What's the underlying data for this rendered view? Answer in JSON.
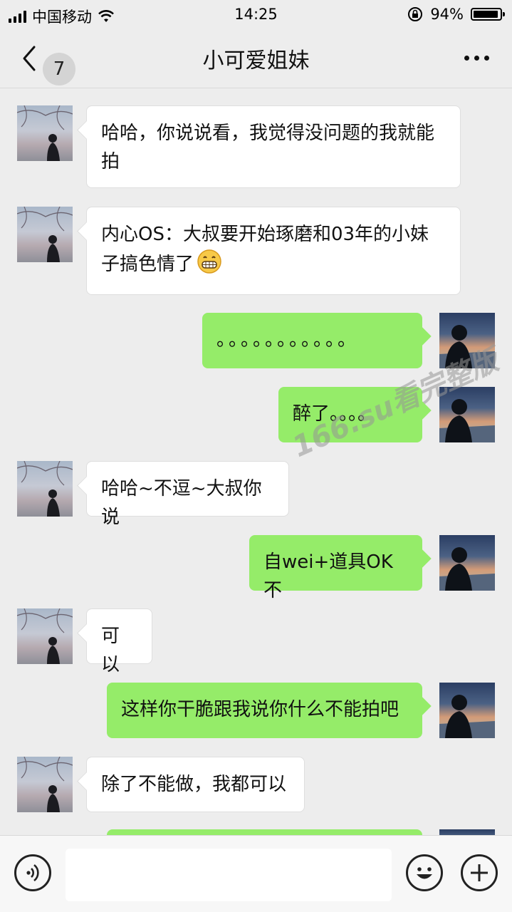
{
  "status_bar": {
    "carrier": "中国移动",
    "time": "14:25",
    "battery": "94%",
    "battery_level": 0.94
  },
  "nav": {
    "back_count": "7",
    "title": "小可爱姐妹"
  },
  "messages": [
    {
      "side": "in",
      "text": "哈哈，你说说看，我觉得没问题的我就能拍"
    },
    {
      "side": "in",
      "text": "内心OS：大叔要开始琢磨和03年的小妹子搞色情了",
      "emoji": "grinning-face-icon"
    },
    {
      "side": "out",
      "text": "。。。。。。。。。。。"
    },
    {
      "side": "out",
      "text": "醉了。。。。"
    },
    {
      "side": "in",
      "text": "哈哈~不逗~大叔你说"
    },
    {
      "side": "out",
      "text": "自wei+道具OK不"
    },
    {
      "side": "in",
      "text": "可以"
    },
    {
      "side": "out",
      "text": "这样你干脆跟我说你什么不能拍吧"
    },
    {
      "side": "in",
      "text": "除了不能做，我都可以"
    },
    {
      "side": "out",
      "text": ""
    }
  ],
  "watermark": "166.su看完整版",
  "input": {
    "placeholder": "",
    "value": ""
  },
  "icons": {
    "voice": "voice-icon",
    "emoji": "emoji-icon",
    "plus": "plus-icon"
  },
  "colors": {
    "outgoing_bubble": "#95ec69",
    "incoming_bubble": "#ffffff",
    "background": "#ededed"
  }
}
